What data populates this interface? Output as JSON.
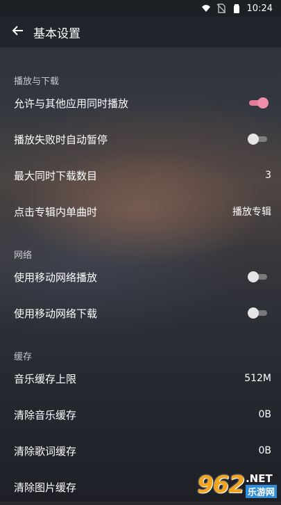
{
  "status_bar": {
    "time": "10:24",
    "icons": [
      "wifi-icon",
      "no-sim-icon",
      "battery-icon"
    ]
  },
  "app_bar": {
    "back_icon": "arrow-left-icon",
    "title": "基本设置"
  },
  "sections": {
    "playback": {
      "header": "播放与下载",
      "allow_simultaneous": {
        "label": "允许与其他应用同时播放",
        "enabled": true
      },
      "auto_pause_on_fail": {
        "label": "播放失败时自动暂停",
        "enabled": false
      },
      "max_downloads": {
        "label": "最大同时下载数目",
        "value": "3"
      },
      "album_song_click": {
        "label": "点击专辑内单曲时",
        "value": "播放专辑"
      }
    },
    "network": {
      "header": "网络",
      "mobile_play": {
        "label": "使用移动网络播放",
        "enabled": false
      },
      "mobile_download": {
        "label": "使用移动网络下载",
        "enabled": false
      }
    },
    "cache": {
      "header": "缓存",
      "music_cache_limit": {
        "label": "音乐缓存上限",
        "value": "512M"
      },
      "clear_music_cache": {
        "label": "清除音乐缓存",
        "value": "0B"
      },
      "clear_lyrics_cache": {
        "label": "清除歌词缓存",
        "value": "0B"
      },
      "clear_image_cache": {
        "label": "清除图片缓存",
        "value": ""
      }
    }
  },
  "watermark": {
    "main": "962",
    "net": ".NET",
    "cn": "乐游网"
  },
  "colors": {
    "toggle_on": "#e37a98",
    "toggle_off": "#b4b4b4",
    "watermark_orange": "#f2a41f",
    "watermark_blue": "#2f8cd8"
  }
}
